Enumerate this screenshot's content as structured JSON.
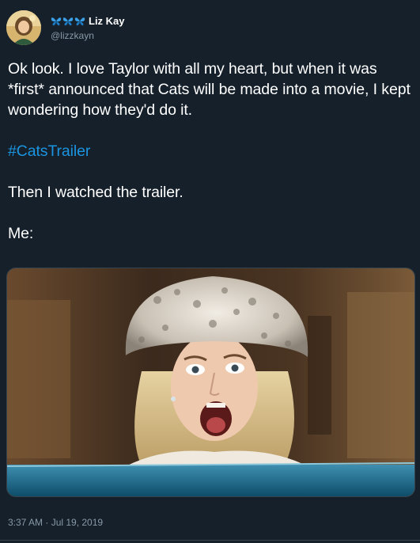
{
  "tweet": {
    "display_name": "Liz Kay",
    "handle": "@lizzkayn",
    "name_emoji": [
      "blue-butterfly",
      "blue-butterfly",
      "blue-butterfly"
    ],
    "text_line_1": "Ok look. I love Taylor with all my heart, but when it was *first* announced that Cats will be made into a movie, I kept wondering how they'd do it.",
    "hashtag": "#CatsTrailer",
    "text_line_3": "Then I watched the trailer.",
    "text_line_4": "Me:",
    "timestamp": "3:37 AM · Jul 19, 2019"
  },
  "colors": {
    "background": "#15202b",
    "text": "#ffffff",
    "secondary_text": "#8899a6",
    "link": "#1b95e0",
    "border": "#38444d"
  }
}
